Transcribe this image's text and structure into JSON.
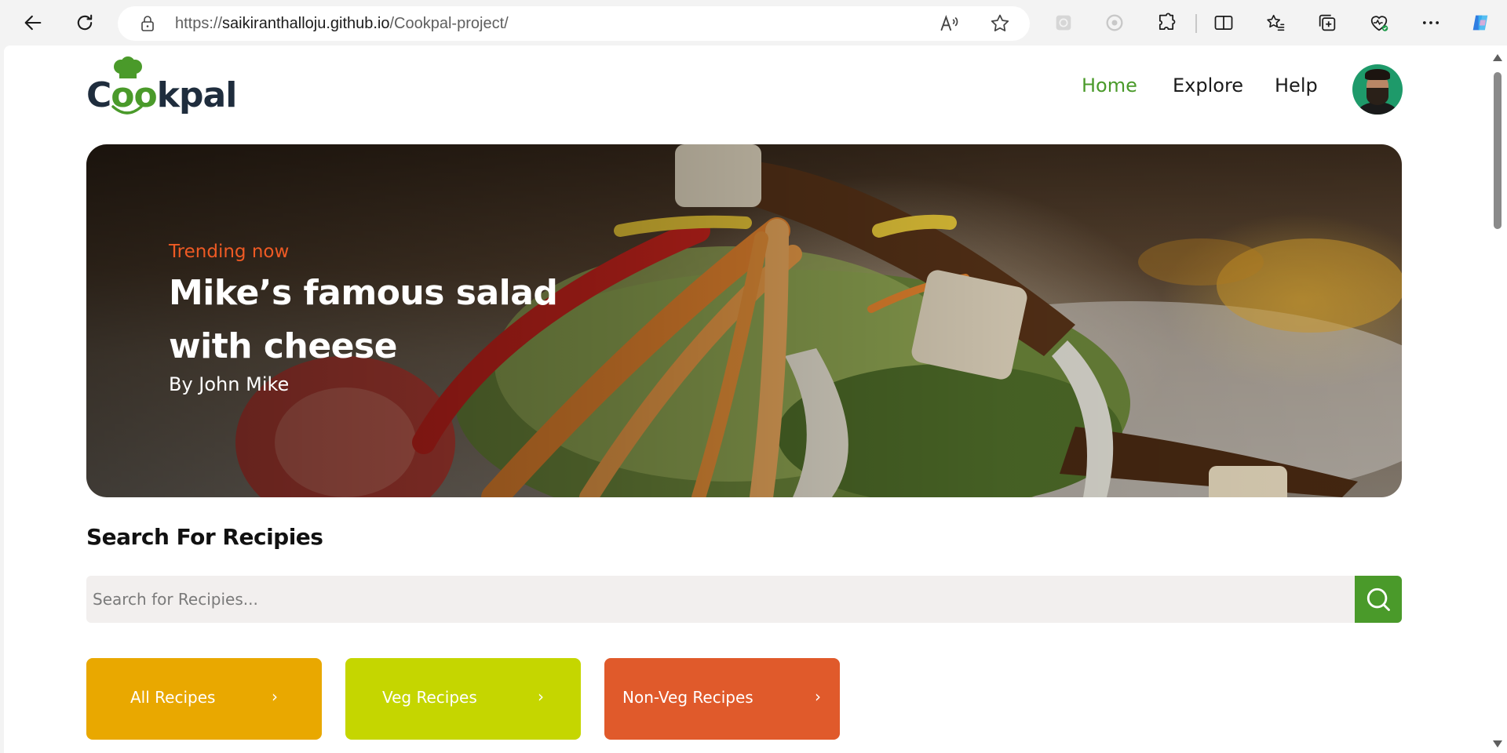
{
  "browser": {
    "url_prefix": "https://",
    "url_host": "saikiranthalloju.github.io",
    "url_path": "/Cookpal-project/"
  },
  "header": {
    "logo_text_c": "C",
    "logo_text_oo": "oo",
    "logo_text_rest": "kpal",
    "nav": [
      {
        "label": "Home",
        "active": true
      },
      {
        "label": "Explore",
        "active": false
      },
      {
        "label": "Help",
        "active": false
      }
    ]
  },
  "hero": {
    "tag": "Trending now",
    "title": "Mike’s famous salad with cheese",
    "author": "By John Mike"
  },
  "search": {
    "heading": "Search For Recipies",
    "placeholder": "Search for Recipies..."
  },
  "categories": [
    {
      "label": "All Recipes",
      "color": "#e9a800",
      "chevron": "›"
    },
    {
      "label": "Veg Recipes",
      "color": "#c5d600",
      "chevron": "›"
    },
    {
      "label": "Non-Veg Recipes",
      "color": "#e05a2b",
      "chevron": "›"
    }
  ],
  "colors": {
    "brand_green": "#4a9a2a",
    "accent_orange": "#ee5a24",
    "search_bg": "#f2efee"
  }
}
